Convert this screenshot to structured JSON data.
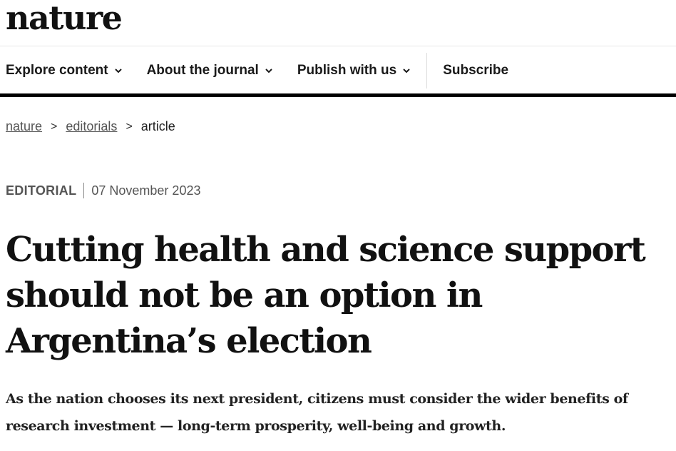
{
  "site": {
    "logo_text": "nature"
  },
  "nav": {
    "items": [
      {
        "label": "Explore content",
        "has_dropdown": true
      },
      {
        "label": "About the journal",
        "has_dropdown": true
      },
      {
        "label": "Publish with us",
        "has_dropdown": true
      },
      {
        "label": "Subscribe",
        "has_dropdown": false
      }
    ],
    "chevron_icon": "chevron-down-icon"
  },
  "breadcrumb": {
    "items": [
      "nature",
      "editorials",
      "article"
    ],
    "separator": ">"
  },
  "article": {
    "type": "EDITORIAL",
    "date": "07 November 2023",
    "title": "Cutting health and science support should not be an option in Argentina’s election",
    "standfirst": "As the nation chooses its next president, citizens must consider the wider benefits of research investment — long-term prosperity, well-being and growth."
  },
  "colors": {
    "text": "#1a1a1a",
    "rule": "#000000",
    "muted": "#555555"
  }
}
